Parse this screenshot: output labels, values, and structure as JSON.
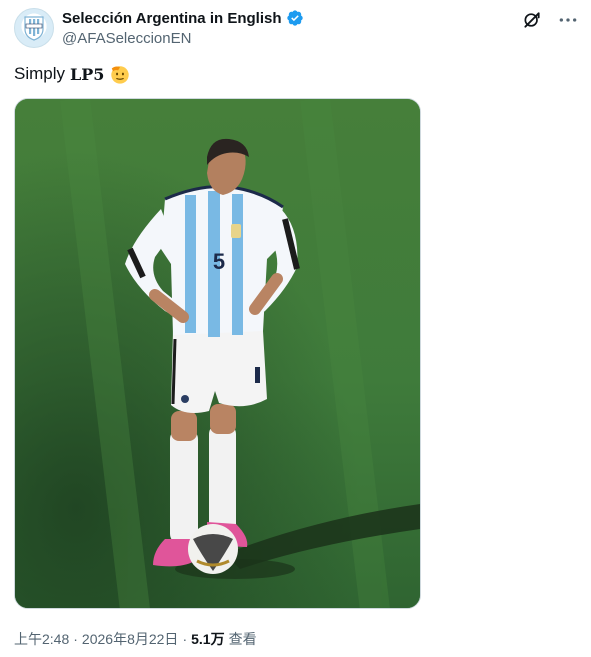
{
  "author": {
    "display_name": "Selección Argentina in English",
    "handle": "@AFASeleccionEN",
    "verified": true
  },
  "tweet": {
    "text_plain": "Simply",
    "text_bold": "LP5",
    "emoji": "saluting-face"
  },
  "media": {
    "image_alt": "Argentina player wearing number 5 standing with hands on hips beside a football on a grass pitch",
    "shirt_number": "5"
  },
  "meta": {
    "time": "上午2:48",
    "sep1": "·",
    "date": "2026年8月22日",
    "sep2": "·",
    "views_count": "5.1万",
    "views_label": "查看"
  },
  "icons": {
    "grok": "grok-icon",
    "more": "more-icon"
  },
  "colors": {
    "verified_blue": "#1d9bf0",
    "text_primary": "#0f1419",
    "text_secondary": "#536471",
    "pitch_green": "#3f7d3b"
  }
}
